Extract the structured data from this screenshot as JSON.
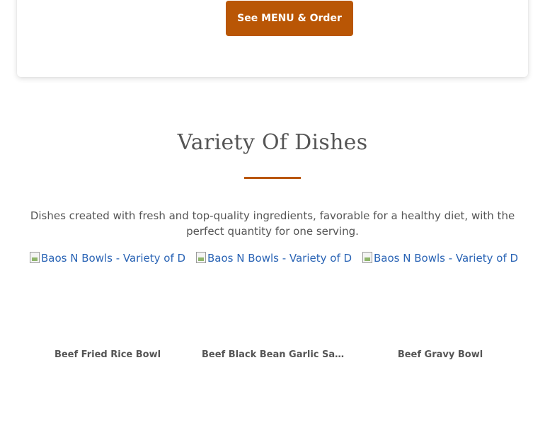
{
  "top_card": {
    "menu_button_label": "See MENU & Order"
  },
  "section": {
    "title": "Variety Of Dishes",
    "description": "Dishes created with fresh and top-quality ingredients, favorable for a healthy diet, with the perfect quantity for one serving.",
    "accent_color": "#b95605"
  },
  "dishes": [
    {
      "image_alt": "Baos N Bowls - Variety of Di",
      "name": "Beef Fried Rice Bowl"
    },
    {
      "image_alt": "Baos N Bowls - Variety of Di",
      "name": "Beef Black Bean Garlic Sau..."
    },
    {
      "image_alt": "Baos N Bowls - Variety of Di",
      "name": "Beef Gravy Bowl"
    }
  ]
}
